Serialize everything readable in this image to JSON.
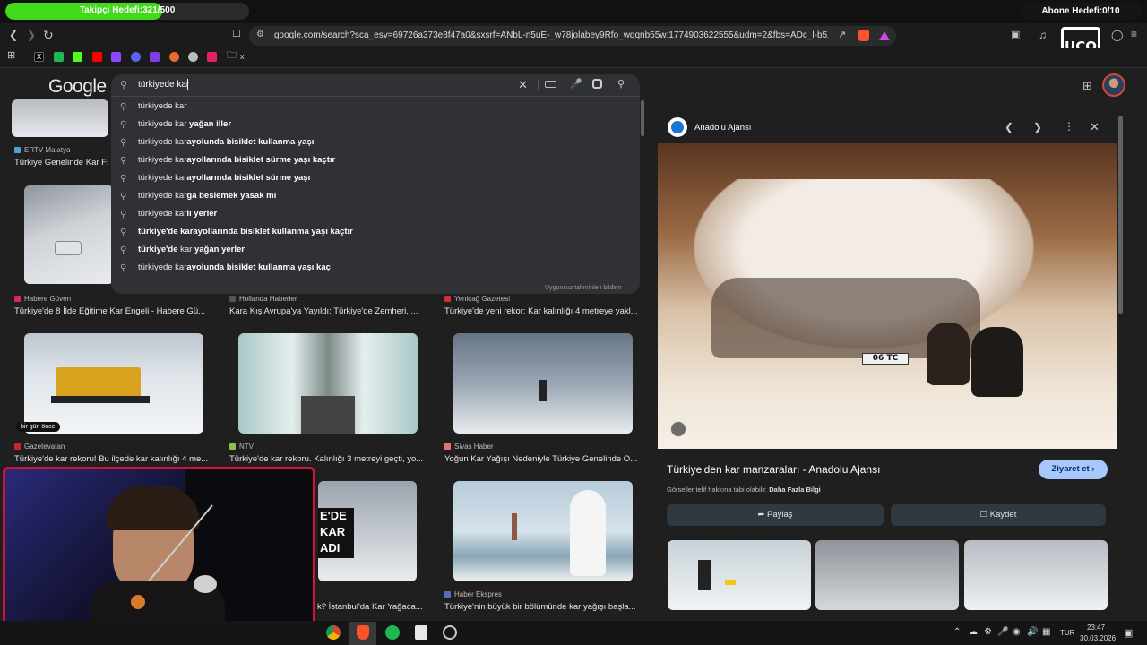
{
  "overlay": {
    "follower_goal": "Takipçi Hedefi:321/500",
    "follower_progress": 0.642,
    "subscriber_goal": "Abone Hedefi:0/10",
    "watermark": "UCO"
  },
  "browser": {
    "url": "google.com/search?sca_esv=69726a373e8f47a0&sxsrf=ANbL-n5uE-_w78jolabey9Rfo_wqqnb55w:1774903622555&udm=2&fbs=ADc_l-b5ZqeLzodp...",
    "nav_icons": [
      "back-icon",
      "forward-icon",
      "reload-icon",
      "bookmark-icon",
      "site-info-icon"
    ],
    "right_icons": [
      "share-icon",
      "brave-shield-icon",
      "brave-rewards-icon",
      "sidebar-icon",
      "media-icon",
      "extensions-icon",
      "vpn-icon",
      "menu-icon"
    ],
    "bookmarks_folder_label": "x"
  },
  "google": {
    "logo": "Google",
    "query": "türkiyede kar",
    "suggestions": [
      {
        "base": "türkiyede kar",
        "bold": ""
      },
      {
        "base": "türkiyede kar ",
        "bold": "yağan iller"
      },
      {
        "base": "türkiyede kar",
        "bold": "ayolunda bisiklet kullanma yaşı"
      },
      {
        "base": "türkiyede kar",
        "bold": "ayollarında bisiklet sürme yaşı kaçtır"
      },
      {
        "base": "türkiyede kar",
        "bold": "ayollarında bisiklet sürme yaşı"
      },
      {
        "base": "türkiyede kar",
        "bold": "ga beslemek yasak mı"
      },
      {
        "base": "türkiyede kar",
        "bold": "lı yerler"
      },
      {
        "base": "",
        "bold": "türkiye'de karayollarında bisiklet kullanma yaşı kaçtır"
      },
      {
        "base": " kar ",
        "bold": "yağan yerler",
        "pre_bold": "türkiye'de"
      },
      {
        "base": "türkiyede kar",
        "bold": "ayolunda bisiklet kullanma yaşı kaç"
      }
    ],
    "report_text": "Uygunsuz tahminleri bildirin",
    "results": [
      {
        "source": "ERTV Malatya",
        "caption": "Türkiye Genelinde Kar Fı",
        "color": "#4aa3df"
      },
      {
        "source": "Habere Güven",
        "caption": "Türkiye'de 8 İlde Eğitime Kar Engeli - Habere Gü...",
        "color": "#e0245e"
      },
      {
        "source": "Hollanda Haberleri",
        "caption": "Kara Kış Avrupa'ya Yayıldı: Türkiye'de Zemheri, ...",
        "color": "#555555"
      },
      {
        "source": "Yeniçağ Gazetesi",
        "caption": "Türkiye'de yeni rekor: Kar kalınlığı 4 metreye yakl...",
        "color": "#d32f2f"
      },
      {
        "source": "Gazetevatan",
        "caption": "Türkiye'de kar rekoru! Bu ilçede kar kalınlığı 4 me...",
        "color": "#c62828"
      },
      {
        "source": "NTV",
        "caption": "Türkiye'de kar rekoru. Kalınlığı 3 metreyi geçti, yo...",
        "color": "#8bc34a"
      },
      {
        "source": "Sivas Haber",
        "caption": "Yoğun Kar Yağışı Nedeniyle Türkiye Genelinde O...",
        "color": "#e57373"
      },
      {
        "source": "",
        "caption": "k? İstanbul'da Kar Yağaca...",
        "color": "#ffffff"
      },
      {
        "source": "Haber Ekspres",
        "caption": "Türkiye'nin büyük bir bölümünde kar yağışı başla...",
        "color": "#5c6bc0"
      }
    ],
    "thumb_badge": "bir gün önce",
    "thumb_text": [
      "E'DE",
      "KAR",
      "ADI"
    ]
  },
  "panel": {
    "source": "Anadolu Ajansı",
    "headline": "Türkiye'den kar manzaraları - Anadolu Ajansı",
    "note": "Görseller telif hakkına tabi olabilir.",
    "note_link": "Daha Fazla Bilgi",
    "visit_label": "Ziyaret et",
    "share_label": "Paylaş",
    "save_label": "Kaydet",
    "plate": "06 TC"
  },
  "taskbar": {
    "lang": "TUR",
    "time": "23:47",
    "date": "30.03.2026"
  }
}
